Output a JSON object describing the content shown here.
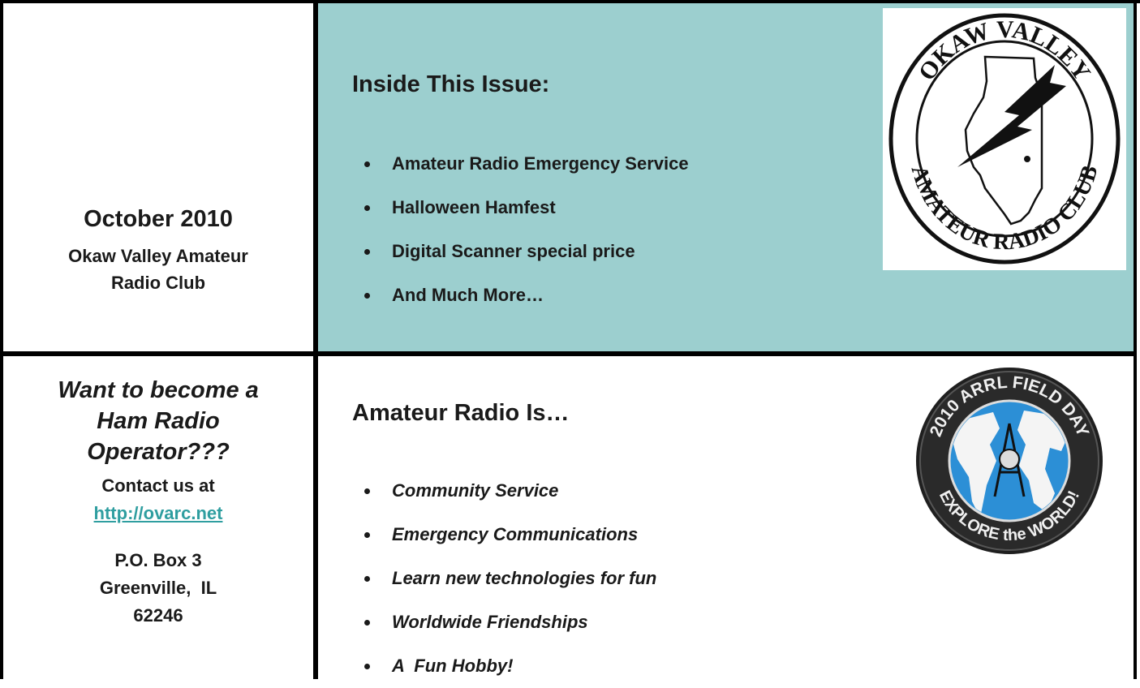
{
  "header": {
    "date": "October 2010",
    "club_line1": "Okaw Valley Amateur",
    "club_line2": "Radio Club"
  },
  "inside": {
    "heading": "Inside This Issue:",
    "items": [
      "Amateur Radio Emergency Service",
      "Halloween Hamfest",
      "Digital Scanner special price",
      "And Much More…"
    ],
    "logo": {
      "name": "okaw-valley-logo",
      "top_text": "OKAW VALLEY",
      "bottom_text": "AMATEUR RADIO CLUB"
    }
  },
  "promo": {
    "want_line1": "Want to become a",
    "want_line2": "Ham Radio",
    "want_line3": "Operator???",
    "contact": "Contact us at",
    "link": "http://ovarc.net",
    "addr_line1": "P.O. Box 3",
    "addr_line2": "Greenville,  IL",
    "addr_line3": "62246"
  },
  "amateur": {
    "heading": "Amateur Radio Is…",
    "items": [
      "Community Service",
      "Emergency Communications",
      "Learn new technologies for fun",
      "Worldwide Friendships",
      "A  Fun Hobby!"
    ],
    "badge": {
      "name": "arrl-field-day-badge",
      "top_text": "2010 ARRL FIELD DAY",
      "bottom_text": "EXPLORE the WORLD!"
    }
  },
  "colors": {
    "teal_panel": "#9ccfcf",
    "link": "#2f9ea0",
    "frame": "#000000",
    "globe": "#2c8fd6"
  }
}
